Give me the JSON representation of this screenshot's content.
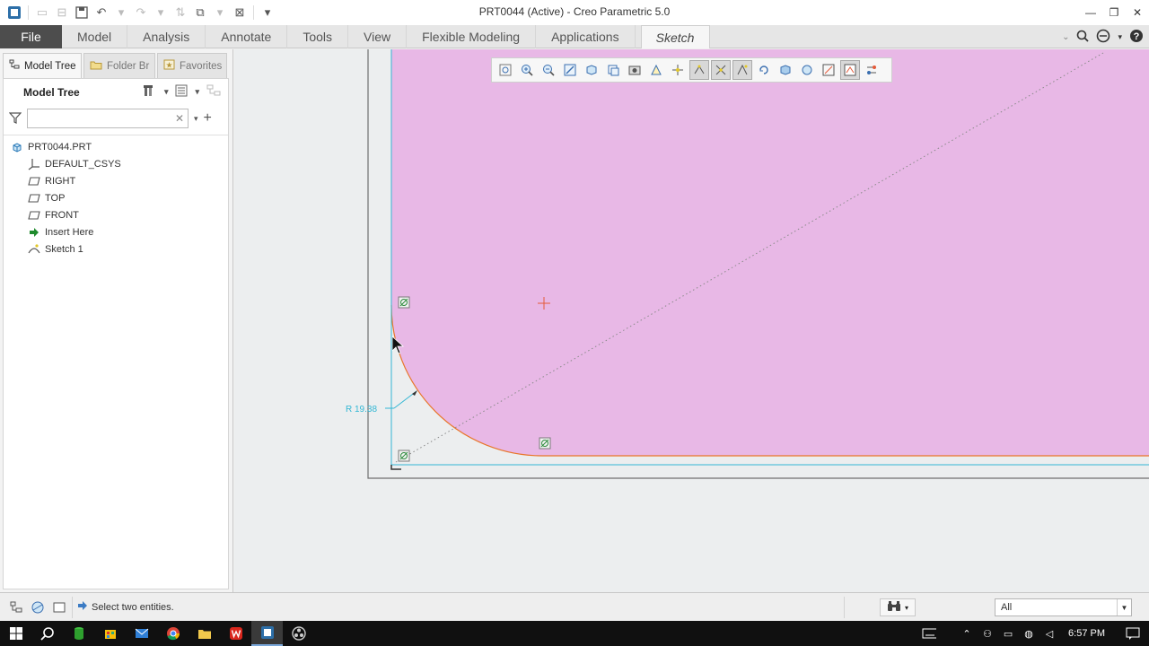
{
  "window": {
    "title": "PRT0044 (Active) - Creo Parametric 5.0"
  },
  "ribbon": {
    "tabs": [
      {
        "label": "File"
      },
      {
        "label": "Model"
      },
      {
        "label": "Analysis"
      },
      {
        "label": "Annotate"
      },
      {
        "label": "Tools"
      },
      {
        "label": "View"
      },
      {
        "label": "Flexible Modeling"
      },
      {
        "label": "Applications"
      }
    ],
    "active_tab": "Sketch"
  },
  "left_panel": {
    "tabs": [
      {
        "label": "Model Tree"
      },
      {
        "label": "Folder Br"
      },
      {
        "label": "Favorites"
      }
    ],
    "header": "Model Tree",
    "filter_value": "",
    "tree": [
      {
        "label": "PRT0044.PRT",
        "icon": "part-icon"
      },
      {
        "label": "DEFAULT_CSYS",
        "icon": "csys-icon"
      },
      {
        "label": "RIGHT",
        "icon": "datum-plane-icon"
      },
      {
        "label": "TOP",
        "icon": "datum-plane-icon"
      },
      {
        "label": "FRONT",
        "icon": "datum-plane-icon"
      },
      {
        "label": "Insert Here",
        "icon": "insert-arrow-icon"
      },
      {
        "label": "Sketch 1",
        "icon": "sketch-icon"
      }
    ]
  },
  "sketch": {
    "dimension_label": "R 19.38",
    "fill_color": "#e8b8e6",
    "edge_color": "#e8762a",
    "constraint_color": "#33b7d4"
  },
  "status": {
    "message": "Select two entities.",
    "filter_value": "All"
  },
  "taskbar": {
    "clock": "6:57 PM"
  }
}
